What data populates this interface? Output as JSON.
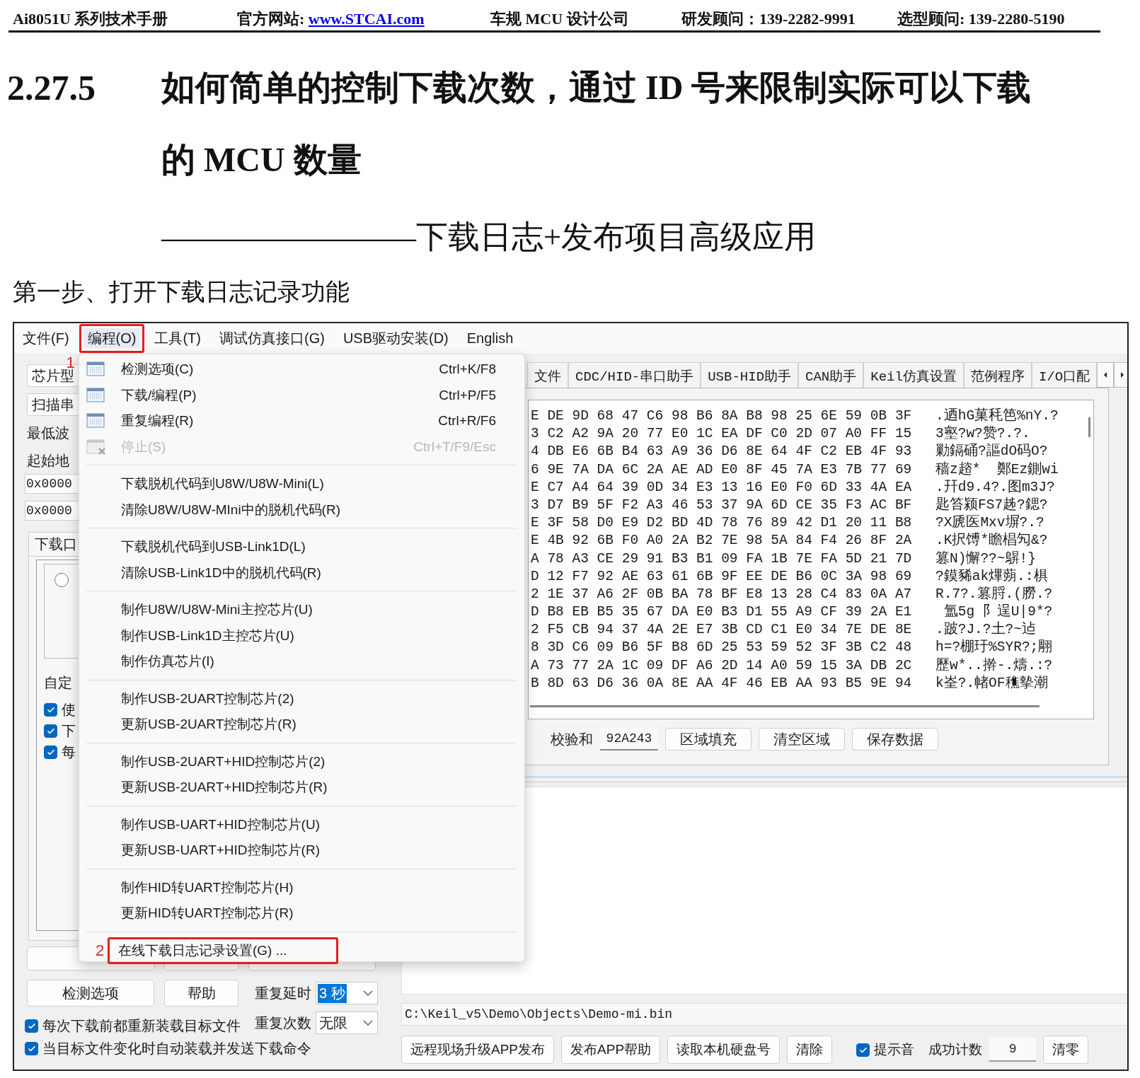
{
  "header": {
    "manual": "Ai8051U 系列技术手册",
    "site_label": "官方网站:",
    "site_link": "www.STCAI.com",
    "company": "车规 MCU 设计公司",
    "rd_contact": "研发顾问：139-2282-9991",
    "sales_contact": "选型顾问: 139-2280-5190"
  },
  "section": {
    "number": "2.27.5",
    "title": "如何简单的控制下载次数，通过 ID 号来限制实际可以下载的 MCU 数量",
    "subtitle": "————————下载日志+发布项目高级应用",
    "step": "第一步、打开下载日志记录功能"
  },
  "app": {
    "menu_bar": [
      {
        "label": "文件(F)",
        "selected": false
      },
      {
        "label": "编程(O)",
        "selected": true,
        "marker": "1"
      },
      {
        "label": "工具(T)",
        "selected": false
      },
      {
        "label": "调试仿真接口(G)",
        "selected": false
      },
      {
        "label": "USB驱动安装(D)",
        "selected": false
      },
      {
        "label": "English",
        "selected": false
      }
    ],
    "menu": [
      {
        "kind": "command",
        "label": "检测选项(C)",
        "shortcut": "Ctrl+K/F8",
        "disabled": false
      },
      {
        "kind": "command",
        "label": "下载/编程(P)",
        "shortcut": "Ctrl+P/F5",
        "disabled": false
      },
      {
        "kind": "command",
        "label": "重复编程(R)",
        "shortcut": "Ctrl+R/F6",
        "disabled": false
      },
      {
        "kind": "command",
        "label": "停止(S)",
        "shortcut": "Ctrl+T/F9/Esc",
        "disabled": true
      },
      {
        "kind": "separator"
      },
      {
        "kind": "action",
        "label": "下载脱机代码到U8W/U8W-Mini(L)",
        "disabled": false
      },
      {
        "kind": "action",
        "label": "清除U8W/U8W-MIni中的脱机代码(R)",
        "disabled": false
      },
      {
        "kind": "separator"
      },
      {
        "kind": "action",
        "label": "下载脱机代码到USB-Link1D(L)",
        "disabled": false
      },
      {
        "kind": "action",
        "label": "清除USB-Link1D中的脱机代码(R)",
        "disabled": false
      },
      {
        "kind": "separator"
      },
      {
        "kind": "action",
        "label": "制作U8W/U8W-Mini主控芯片(U)",
        "disabled": false
      },
      {
        "kind": "action",
        "label": "制作USB-Link1D主控芯片(U)",
        "disabled": false
      },
      {
        "kind": "action",
        "label": "制作仿真芯片(I)",
        "disabled": false
      },
      {
        "kind": "separator"
      },
      {
        "kind": "action",
        "label": "制作USB-2UART控制芯片(2)",
        "disabled": false
      },
      {
        "kind": "action",
        "label": "更新USB-2UART控制芯片(R)",
        "disabled": false
      },
      {
        "kind": "separator"
      },
      {
        "kind": "action",
        "label": "制作USB-2UART+HID控制芯片(2)",
        "disabled": false
      },
      {
        "kind": "action",
        "label": "更新USB-2UART+HID控制芯片(R)",
        "disabled": false
      },
      {
        "kind": "separator"
      },
      {
        "kind": "action",
        "label": "制作USB-UART+HID控制芯片(U)",
        "disabled": false
      },
      {
        "kind": "action",
        "label": "更新USB-UART+HID控制芯片(R)",
        "disabled": false
      },
      {
        "kind": "separator"
      },
      {
        "kind": "action",
        "label": "制作HID转UART控制芯片(H)",
        "disabled": false
      },
      {
        "kind": "action",
        "label": "更新HID转UART控制芯片(R)",
        "disabled": false
      },
      {
        "kind": "separator"
      },
      {
        "kind": "action",
        "label": "在线下载日志记录设置(G) ...",
        "disabled": false,
        "marker": "2"
      }
    ],
    "left_panel": {
      "top_buttons": [
        "芯片型",
        "扫描串"
      ],
      "labels": [
        "最低波",
        "起始地"
      ],
      "address_inputs": [
        "0x0000",
        "0x0000"
      ],
      "tab": "下载口",
      "radio": {
        "checked": false
      },
      "custom_label": "自定",
      "checkboxes": [
        {
          "label": "使",
          "checked": true
        },
        {
          "label": "下",
          "checked": true
        },
        {
          "label": "每",
          "checked": true
        }
      ],
      "check_button": "检测选项",
      "help_button": "帮助",
      "repeat_delay": {
        "label": "重复延时",
        "value": "3 秒",
        "highlighted": true
      },
      "repeat_count": {
        "label": "重复次数",
        "value": "无限",
        "highlighted": false
      },
      "options": [
        {
          "label": "每次下载前都重新装载目标文件",
          "checked": true
        },
        {
          "label": "当目标文件变化时自动装载并发送下载命令",
          "checked": true
        }
      ]
    },
    "tabs": [
      {
        "label": "文件"
      },
      {
        "label": "CDC/HID-串口助手"
      },
      {
        "label": "USB-HID助手"
      },
      {
        "label": "CAN助手"
      },
      {
        "label": "Keil仿真设置"
      },
      {
        "label": "范例程序"
      },
      {
        "label": "I/O口配"
      }
    ],
    "hex_rows": [
      {
        "hex": "E DE 9D 68 47 C6 98 B6 8A B8 98 25 6E 59 0B 3F",
        "ascii": ".迺hG菓秏笆%nY.?"
      },
      {
        "hex": "3 C2 A2 9A 20 77 E0 1C EA DF C0 2D 07 A0 FF 15",
        "ascii": "3壑?w?赞?.?."
      },
      {
        "hex": "4 DB E6 6B B4 63 A9 36 D6 8E 64 4F C2 EB 4F 93",
        "ascii": "勦鎘硧?謳dO码O?"
      },
      {
        "hex": "6 9E 7A DA 6C 2A AE AD E0 8F 45 7A E3 7B 77 69",
        "ascii": "穑z趦*  鄭Ez鍘wi"
      },
      {
        "hex": "E C7 A4 64 39 0D 34 E3 13 16 E0 F0 6D 33 4A EA",
        "ascii": ".幵d9.4?.图m3J?"
      },
      {
        "hex": "3 D7 B9 5F F2 A3 46 53 37 9A 6D CE 35 F3 AC BF",
        "ascii": "匙笞颍FS7趀?鍶?"
      },
      {
        "hex": "E 3F 58 D0 E9 D2 BD 4D 78 76 89 42 D1 20 11 B8",
        "ascii": "?X虒医Mxv塀?.?"
      },
      {
        "hex": "E 4B 92 6B F0 A0 2A B2 7E 98 5A 84 F4 26 8F 2A",
        "ascii": ".K択馎*瞻椙勼&?"
      },
      {
        "hex": "A 78 A3 CE 29 91 B3 B1 09 FA 1B 7E FA 5D 21 7D",
        "ascii": "篡N)懈??~鵿!}"
      },
      {
        "hex": "D 12 F7 92 AE 63 61 6B 9F EE DE B6 0C 3A 98 69",
        "ascii": "?鏌豨ak熚蒴.:椇"
      },
      {
        "hex": "2 1E 37 A6 2F 0B BA 78 BF E8 13 28 C4 83 0A A7",
        "ascii": "R.7?.篡脟.(朥.?"
      },
      {
        "hex": "D B8 EB B5 35 67 DA E0 B3 D1 55 A9 CF 39 2A E1",
        "ascii": " 氲5g 阝逞U|9*?"
      },
      {
        "hex": "2 F5 CB 94 37 4A 2E E7 3B CD C1 E0 34 7E DE 8E",
        "ascii": ".跛?J.?土?~迠"
      },
      {
        "hex": "8 3D C6 09 B6 5F B8 6D 25 53 59 52 3F 3B C2 48",
        "ascii": "h=?棚玗%SYR?;翢"
      },
      {
        "hex": "A 73 77 2A 1C 09 DF A6 2D 14 A0 59 15 3A DB 2C",
        "ascii": "歷w*..擀-.燽.:?"
      },
      {
        "hex": "B 8D 63 D6 36 0A 8E AA 4F 46 EB AA 93 B5 9E 94",
        "ascii": "k峑?.帾OF穛摰潮"
      }
    ],
    "checksum_label": "校验和",
    "checksum": "92A243",
    "hex_buttons": [
      "区域填充",
      "清空区域",
      "保存数据"
    ],
    "file_path": "C:\\Keil_v5\\Demo\\Objects\\Demo-mi.bin",
    "bottom_buttons": [
      "远程现场升级APP发布",
      "发布APP帮助",
      "读取本机硬盘号",
      "清除"
    ],
    "beep": {
      "label": "提示音",
      "checked": true
    },
    "success_label": "成功计数",
    "success_count": "9",
    "reset_button": "清零"
  }
}
